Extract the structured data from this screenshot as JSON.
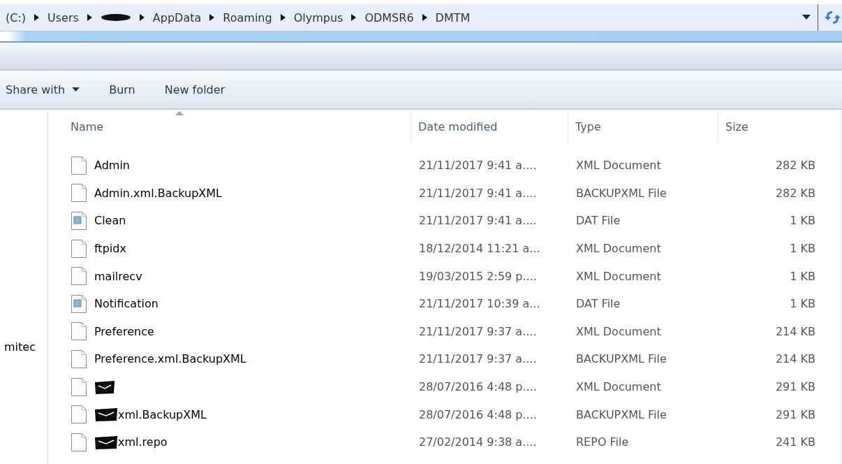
{
  "address_bar": {
    "crumbs": [
      {
        "label": "(C:)",
        "redacted": false
      },
      {
        "label": "Users",
        "redacted": false
      },
      {
        "redacted": true
      },
      {
        "label": "AppData",
        "redacted": false
      },
      {
        "label": "Roaming",
        "redacted": false
      },
      {
        "label": "Olympus",
        "redacted": false
      },
      {
        "label": "ODMSR6",
        "redacted": false
      },
      {
        "label": "DMTM",
        "redacted": false
      }
    ]
  },
  "toolbar": [
    {
      "label": "Share with",
      "has_menu": true
    },
    {
      "label": "Burn",
      "has_menu": false
    },
    {
      "label": "New folder",
      "has_menu": false
    }
  ],
  "navigation_pane": {
    "items": [
      "mitec"
    ]
  },
  "table": {
    "columns": [
      {
        "label": "Name",
        "sorted": true
      },
      {
        "label": "Date modified",
        "sorted": false
      },
      {
        "label": "Type",
        "sorted": false
      },
      {
        "label": "Size",
        "sorted": false
      }
    ],
    "rows": [
      {
        "kind": "document",
        "redacted": false,
        "name": "Admin",
        "date": "21/11/2017 9:41 a....",
        "type": "XML Document",
        "size": "282 KB"
      },
      {
        "kind": "document",
        "redacted": false,
        "name": "Admin.xml.BackupXML",
        "date": "21/11/2017 9:41 a....",
        "type": "BACKUPXML File",
        "size": "282 KB"
      },
      {
        "kind": "data",
        "redacted": false,
        "name": "Clean",
        "date": "21/11/2017 9:41 a....",
        "type": "DAT File",
        "size": "1 KB"
      },
      {
        "kind": "document",
        "redacted": false,
        "name": "ftpidx",
        "date": "18/12/2014 11:21 a...",
        "type": "XML Document",
        "size": "1 KB"
      },
      {
        "kind": "document",
        "redacted": false,
        "name": "mailrecv",
        "date": "19/03/2015 2:59 p....",
        "type": "XML Document",
        "size": "1 KB"
      },
      {
        "kind": "data",
        "redacted": false,
        "name": "Notification",
        "date": "21/11/2017 10:39 a...",
        "type": "DAT File",
        "size": "1 KB"
      },
      {
        "kind": "document",
        "redacted": false,
        "name": "Preference",
        "date": "21/11/2017 9:37 a....",
        "type": "XML Document",
        "size": "214 KB"
      },
      {
        "kind": "document",
        "redacted": false,
        "name": "Preference.xml.BackupXML",
        "date": "21/11/2017 9:37 a....",
        "type": "BACKUPXML File",
        "size": "214 KB"
      },
      {
        "kind": "document",
        "redacted": true,
        "date": "28/07/2016 4:48 p....",
        "type": "XML Document",
        "size": "291 KB"
      },
      {
        "kind": "document",
        "redacted": true,
        "name": "xml.BackupXML",
        "date": "28/07/2016 4:48 p....",
        "type": "BACKUPXML File",
        "size": "291 KB"
      },
      {
        "kind": "document",
        "redacted": true,
        "name": "xml.repo",
        "date": "27/02/2014 9:38 a....",
        "type": "REPO File",
        "size": "241 KB"
      }
    ]
  }
}
